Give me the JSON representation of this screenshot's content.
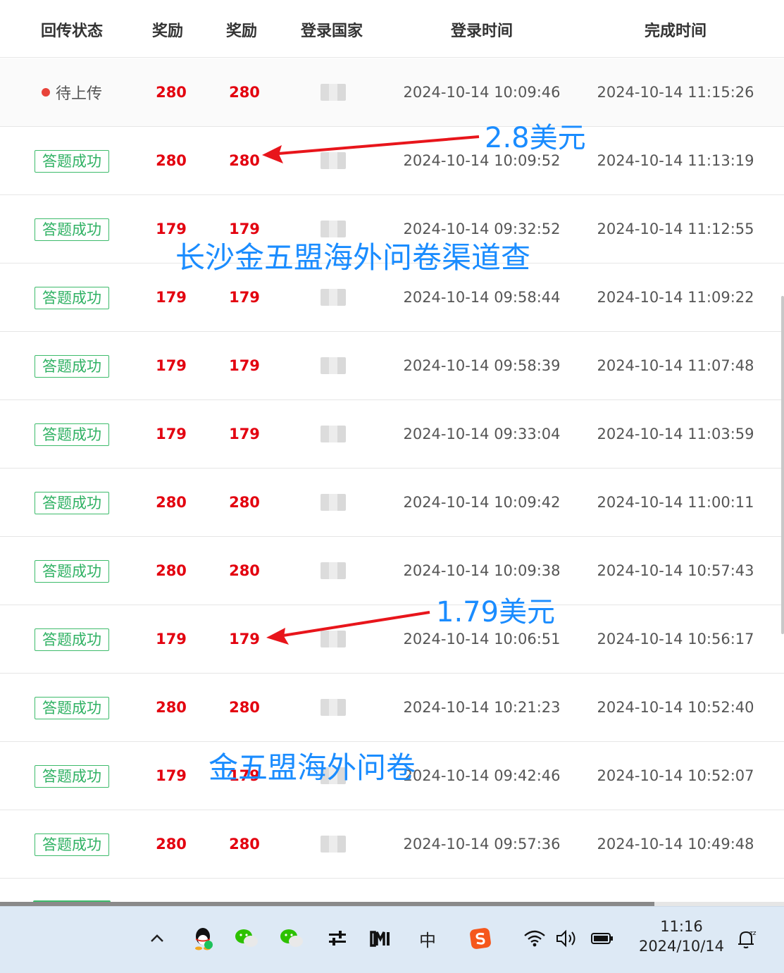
{
  "table": {
    "headers": [
      "回传状态",
      "奖励",
      "奖励",
      "登录国家",
      "登录时间",
      "完成时间"
    ],
    "rows": [
      {
        "status": "待上传",
        "reward1": "280",
        "reward2": "280",
        "login": "2024-10-14 10:09:46",
        "done": "2024-10-14 11:15:26"
      },
      {
        "status": "答题成功",
        "reward1": "280",
        "reward2": "280",
        "login": "2024-10-14 10:09:52",
        "done": "2024-10-14 11:13:19"
      },
      {
        "status": "答题成功",
        "reward1": "179",
        "reward2": "179",
        "login": "2024-10-14 09:32:52",
        "done": "2024-10-14 11:12:55"
      },
      {
        "status": "答题成功",
        "reward1": "179",
        "reward2": "179",
        "login": "2024-10-14 09:58:44",
        "done": "2024-10-14 11:09:22"
      },
      {
        "status": "答题成功",
        "reward1": "179",
        "reward2": "179",
        "login": "2024-10-14 09:58:39",
        "done": "2024-10-14 11:07:48"
      },
      {
        "status": "答题成功",
        "reward1": "179",
        "reward2": "179",
        "login": "2024-10-14 09:33:04",
        "done": "2024-10-14 11:03:59"
      },
      {
        "status": "答题成功",
        "reward1": "280",
        "reward2": "280",
        "login": "2024-10-14 10:09:42",
        "done": "2024-10-14 11:00:11"
      },
      {
        "status": "答题成功",
        "reward1": "280",
        "reward2": "280",
        "login": "2024-10-14 10:09:38",
        "done": "2024-10-14 10:57:43"
      },
      {
        "status": "答题成功",
        "reward1": "179",
        "reward2": "179",
        "login": "2024-10-14 10:06:51",
        "done": "2024-10-14 10:56:17"
      },
      {
        "status": "答题成功",
        "reward1": "280",
        "reward2": "280",
        "login": "2024-10-14 10:21:23",
        "done": "2024-10-14 10:52:40"
      },
      {
        "status": "答题成功",
        "reward1": "179",
        "reward2": "179",
        "login": "2024-10-14 09:42:46",
        "done": "2024-10-14 10:52:07"
      },
      {
        "status": "答题成功",
        "reward1": "280",
        "reward2": "280",
        "login": "2024-10-14 09:57:36",
        "done": "2024-10-14 10:49:48"
      }
    ]
  },
  "annotations": {
    "usd_280": "2.8美元",
    "watermark_top": "长沙金五盟海外问卷渠道查",
    "usd_179": "1.79美元",
    "watermark_bottom": "金五盟海外问卷",
    "arrow_color": "#e8151b",
    "text_color": "#1a8cff"
  },
  "taskbar": {
    "icons": [
      "chevron-up-icon",
      "qq-icon",
      "wechat-icon",
      "wechat-icon",
      "settings-sliders-icon",
      "m-app-icon",
      "ime-zhong-icon",
      "sogou-input-icon",
      "wifi-icon",
      "volume-icon",
      "battery-icon",
      "notification-icon"
    ],
    "ime_label": "中",
    "clock_time": "11:16",
    "clock_date": "2024/10/14"
  },
  "colors": {
    "success_green": "#2fb163",
    "reward_red": "#e3000f",
    "pending_dot": "#e8433a",
    "taskbar_bg": "#dde9f5"
  }
}
